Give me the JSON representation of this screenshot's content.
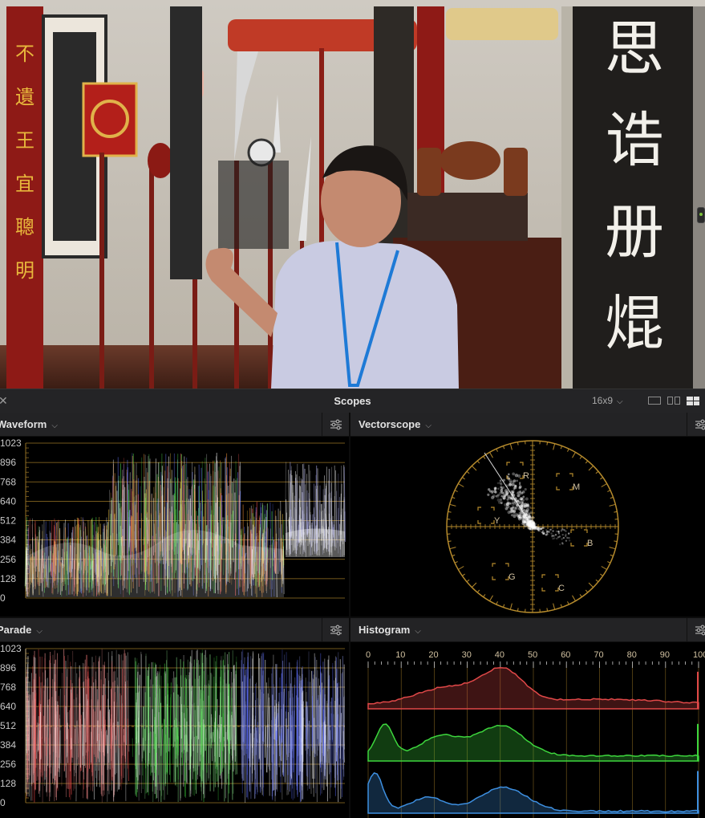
{
  "viewer": {
    "sign_chars": [
      "思",
      "诰",
      "册",
      "焜"
    ],
    "left_column_chars": [
      "不",
      "遺",
      "王",
      "宜",
      "聰",
      "明"
    ]
  },
  "scopes_bar": {
    "title": "Scopes",
    "aspect_ratio": "16x9",
    "close_icon": "close-icon",
    "layout_icons": [
      "single-layout-icon",
      "dual-layout-icon",
      "quad-layout-icon"
    ]
  },
  "panels": {
    "waveform": {
      "title": "Waveform",
      "scale": [
        "1023",
        "896",
        "768",
        "640",
        "512",
        "384",
        "256",
        "128",
        "0"
      ]
    },
    "vectorscope": {
      "title": "Vectorscope",
      "targets": [
        "R",
        "M",
        "B",
        "C",
        "G",
        "Y"
      ]
    },
    "parade": {
      "title": "Parade",
      "scale": [
        "1023",
        "896",
        "768",
        "640",
        "512",
        "384",
        "256",
        "128",
        "0"
      ]
    },
    "histogram": {
      "title": "Histogram",
      "scale": [
        "0",
        "10",
        "20",
        "30",
        "40",
        "50",
        "60",
        "70",
        "80",
        "90",
        "100"
      ]
    }
  },
  "colors": {
    "graticule": "#b58a2c",
    "red_channel": "#e04848",
    "green_channel": "#3dd63d",
    "blue_channel": "#3d8fe0"
  }
}
